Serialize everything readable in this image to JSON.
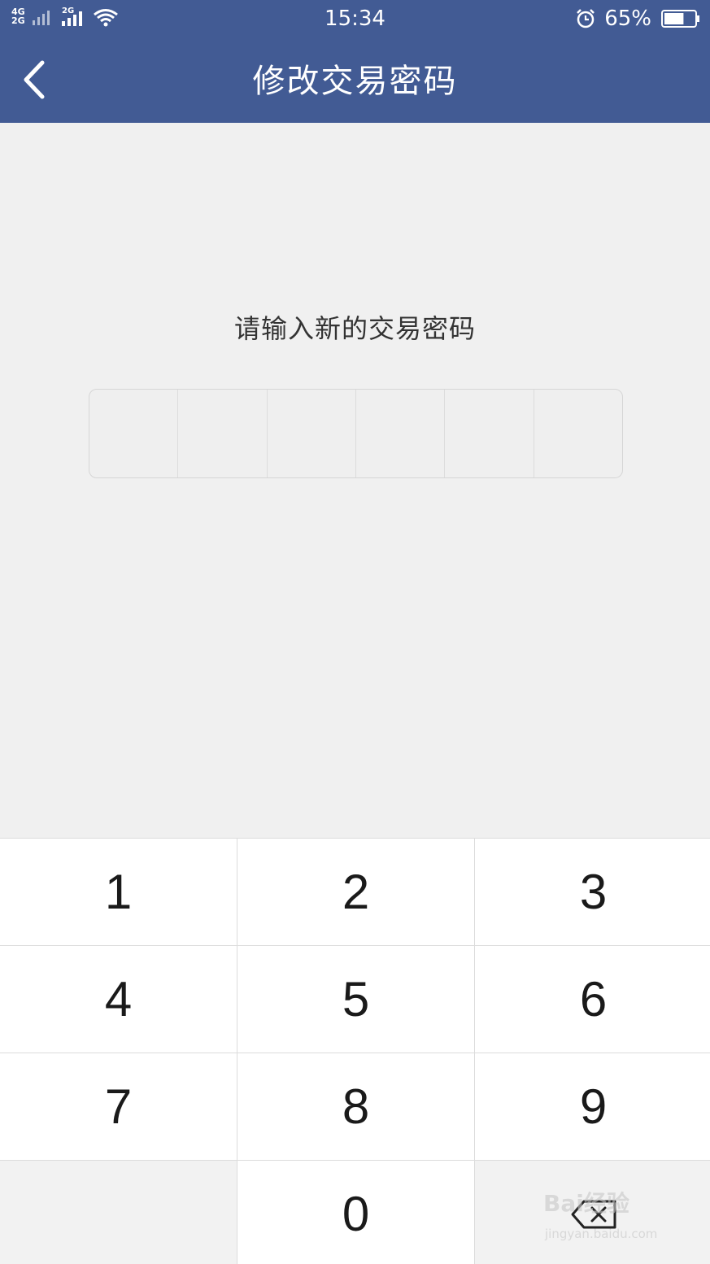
{
  "status_bar": {
    "network_top": "4G",
    "network_bottom": "2G",
    "network_second": "2G",
    "time": "15:34",
    "battery_percent": "65%",
    "battery_level": 0.65,
    "icons": [
      "signal-icon",
      "wifi-icon",
      "alarm-icon",
      "battery-icon"
    ]
  },
  "header": {
    "title": "修改交易密码",
    "back_icon": "chevron-left-icon"
  },
  "main": {
    "prompt": "请输入新的交易密码",
    "pin_length": 6
  },
  "keypad": {
    "keys": [
      "1",
      "2",
      "3",
      "4",
      "5",
      "6",
      "7",
      "8",
      "9",
      "",
      "0",
      ""
    ],
    "delete_icon": "backspace-icon"
  },
  "watermark": {
    "logo": "Bai经验",
    "url": "jingyan.baidu.com"
  },
  "colors": {
    "header_bg": "#425b94",
    "page_bg": "#f0f0f0",
    "key_bg": "#ffffff",
    "key_alt_bg": "#f2f2f2"
  }
}
